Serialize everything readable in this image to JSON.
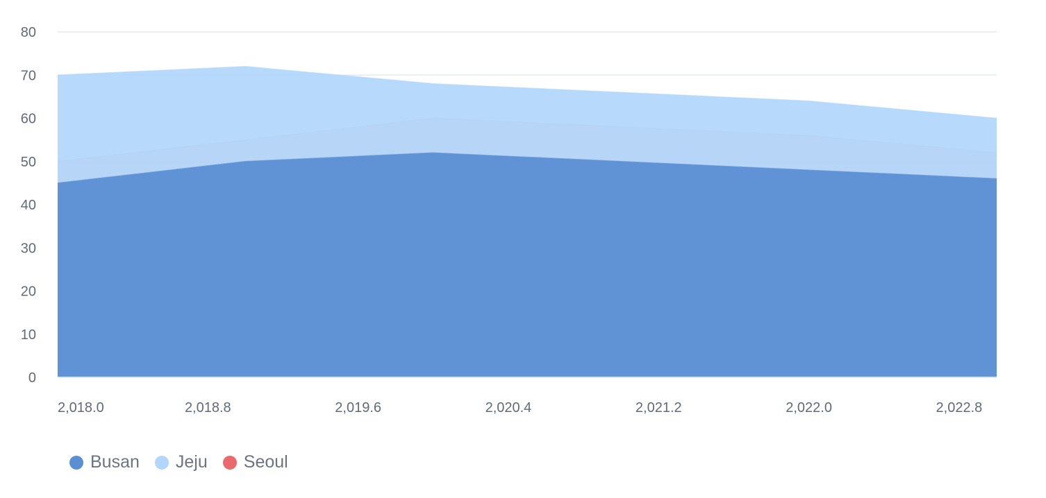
{
  "chart_data": {
    "type": "area",
    "x_ticks": [
      "2,018.0",
      "2,018.8",
      "2,019.6",
      "2,020.4",
      "2,021.2",
      "2,022.0",
      "2,022.8"
    ],
    "x_tick_values": [
      2018.0,
      2018.8,
      2019.6,
      2020.4,
      2021.2,
      2022.0,
      2022.8
    ],
    "xlim": [
      2018,
      2023
    ],
    "y_ticks": [
      "0",
      "10",
      "20",
      "30",
      "40",
      "50",
      "60",
      "70",
      "80"
    ],
    "ylim": [
      0,
      80
    ],
    "x": [
      2018,
      2019,
      2020,
      2021,
      2022,
      2023
    ],
    "series": [
      {
        "name": "Seoul",
        "color": "#e86a6a",
        "values": [
          50,
          55,
          60,
          58,
          56,
          52
        ]
      },
      {
        "name": "Jeju",
        "color": "#b3d7fb",
        "values": [
          70,
          72,
          68,
          66,
          64,
          60
        ]
      },
      {
        "name": "Busan",
        "color": "#5b8fd4",
        "values": [
          45,
          50,
          52,
          50,
          48,
          46
        ]
      }
    ],
    "grid": true,
    "legend": {
      "position": "bottom-left",
      "items": [
        {
          "label": "Busan",
          "color": "#5b8fd4"
        },
        {
          "label": "Jeju",
          "color": "#b3d7fb"
        },
        {
          "label": "Seoul",
          "color": "#e86a6a"
        }
      ]
    }
  }
}
